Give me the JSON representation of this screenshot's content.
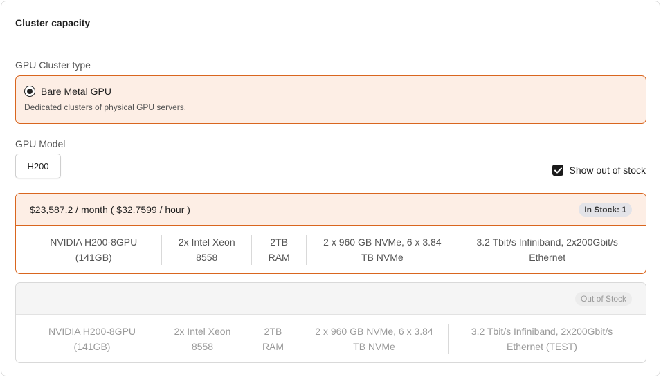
{
  "panel": {
    "title": "Cluster capacity"
  },
  "cluster_type": {
    "label": "GPU Cluster type",
    "option": {
      "title": "Bare Metal GPU",
      "description": "Dedicated clusters of physical GPU servers.",
      "selected": true
    }
  },
  "gpu_model": {
    "label": "GPU Model",
    "value": "H200"
  },
  "show_out_of_stock": {
    "label": "Show out of stock",
    "checked": true
  },
  "offers": [
    {
      "price": "$23,587.2 / month ( $32.7599 / hour )",
      "status": "In Stock: 1",
      "specs": [
        {
          "line1": "NVIDIA H200-8GPU",
          "line2": "(141GB)"
        },
        {
          "line1": "2x Intel Xeon",
          "line2": "8558"
        },
        {
          "line1": "2TB",
          "line2": "RAM"
        },
        {
          "line1": "2 x 960 GB NVMe, 6 x 3.84",
          "line2": "TB NVMe"
        },
        {
          "line1": "3.2 Tbit/s Infiniband, 2x200Gbit/s",
          "line2": "Ethernet"
        }
      ]
    },
    {
      "price": "–",
      "status": "Out of Stock",
      "specs": [
        {
          "line1": "NVIDIA H200-8GPU",
          "line2": "(141GB)"
        },
        {
          "line1": "2x Intel Xeon",
          "line2": "8558"
        },
        {
          "line1": "2TB",
          "line2": "RAM"
        },
        {
          "line1": "2 x 960 GB NVMe, 6 x 3.84",
          "line2": "TB NVMe"
        },
        {
          "line1": "3.2 Tbit/s Infiniband, 2x200Gbit/s",
          "line2": "Ethernet (TEST)"
        }
      ]
    }
  ],
  "colors": {
    "accent": "#d9661f",
    "accent_bg": "#fdeee5"
  }
}
